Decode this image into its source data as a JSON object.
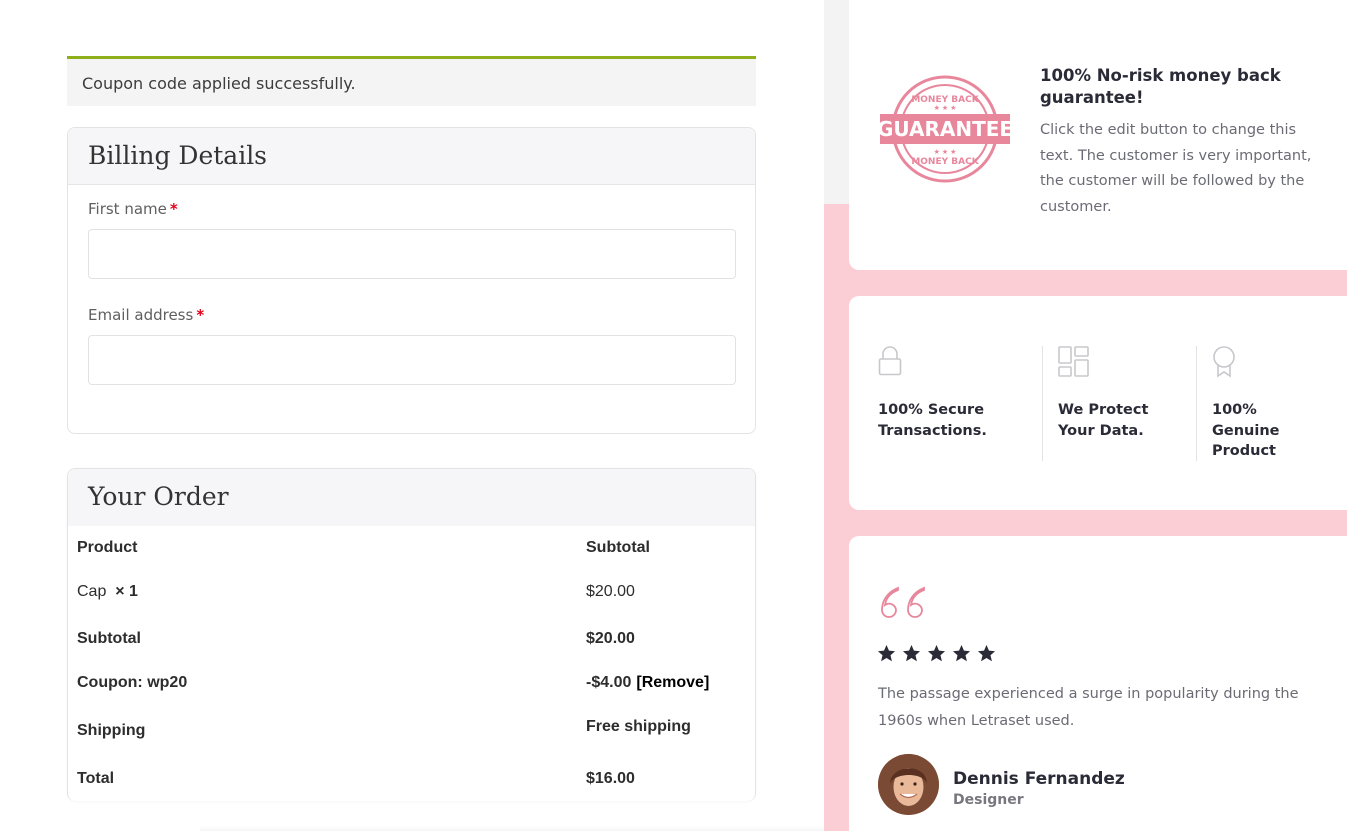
{
  "notice": {
    "text": "Coupon code applied successfully.",
    "accent": "#8fae1b"
  },
  "billing": {
    "title": "Billing Details",
    "fields": [
      {
        "label": "First name",
        "required": "*",
        "value": ""
      },
      {
        "label": "Email address",
        "required": "*",
        "value": ""
      }
    ]
  },
  "order": {
    "title": "Your Order",
    "header": {
      "product": "Product",
      "subtotal": "Subtotal"
    },
    "items": [
      {
        "name": "Cap",
        "qty": "× 1",
        "price": "$20.00"
      }
    ],
    "subtotal": {
      "label": "Subtotal",
      "value": "$20.00"
    },
    "coupon": {
      "label": "Coupon: wp20",
      "value": "-$4.00",
      "remove": "[Remove]"
    },
    "shipping": {
      "label": "Shipping",
      "value": "Free shipping"
    },
    "total": {
      "label": "Total",
      "value": "$16.00"
    }
  },
  "guarantee": {
    "badge_icon": "money-back-guarantee-stamp",
    "badge_text": {
      "top": "MONEY BACK",
      "main": "GUARANTEE",
      "bottom": "MONEY BACK"
    },
    "title": "100% No-risk money back guarantee!",
    "text": "Click the edit button to change this text. The customer is very important, the customer will be followed by the customer."
  },
  "features": [
    {
      "icon": "lock-icon",
      "label": "100% Secure Transactions."
    },
    {
      "icon": "layout-icon",
      "label": "We Protect Your Data."
    },
    {
      "icon": "award-icon",
      "label": "100% Genuine Product"
    }
  ],
  "testimonial": {
    "icon": "quote-icon",
    "rating": 5,
    "text": "The passage experienced a surge in popularity during the 1960s when Letraset used.",
    "name": "Dennis Fernandez",
    "role": "Designer"
  },
  "colors": {
    "pink": "#fbcdd4",
    "badge": "#e8879c",
    "star": "#2b2b37"
  }
}
